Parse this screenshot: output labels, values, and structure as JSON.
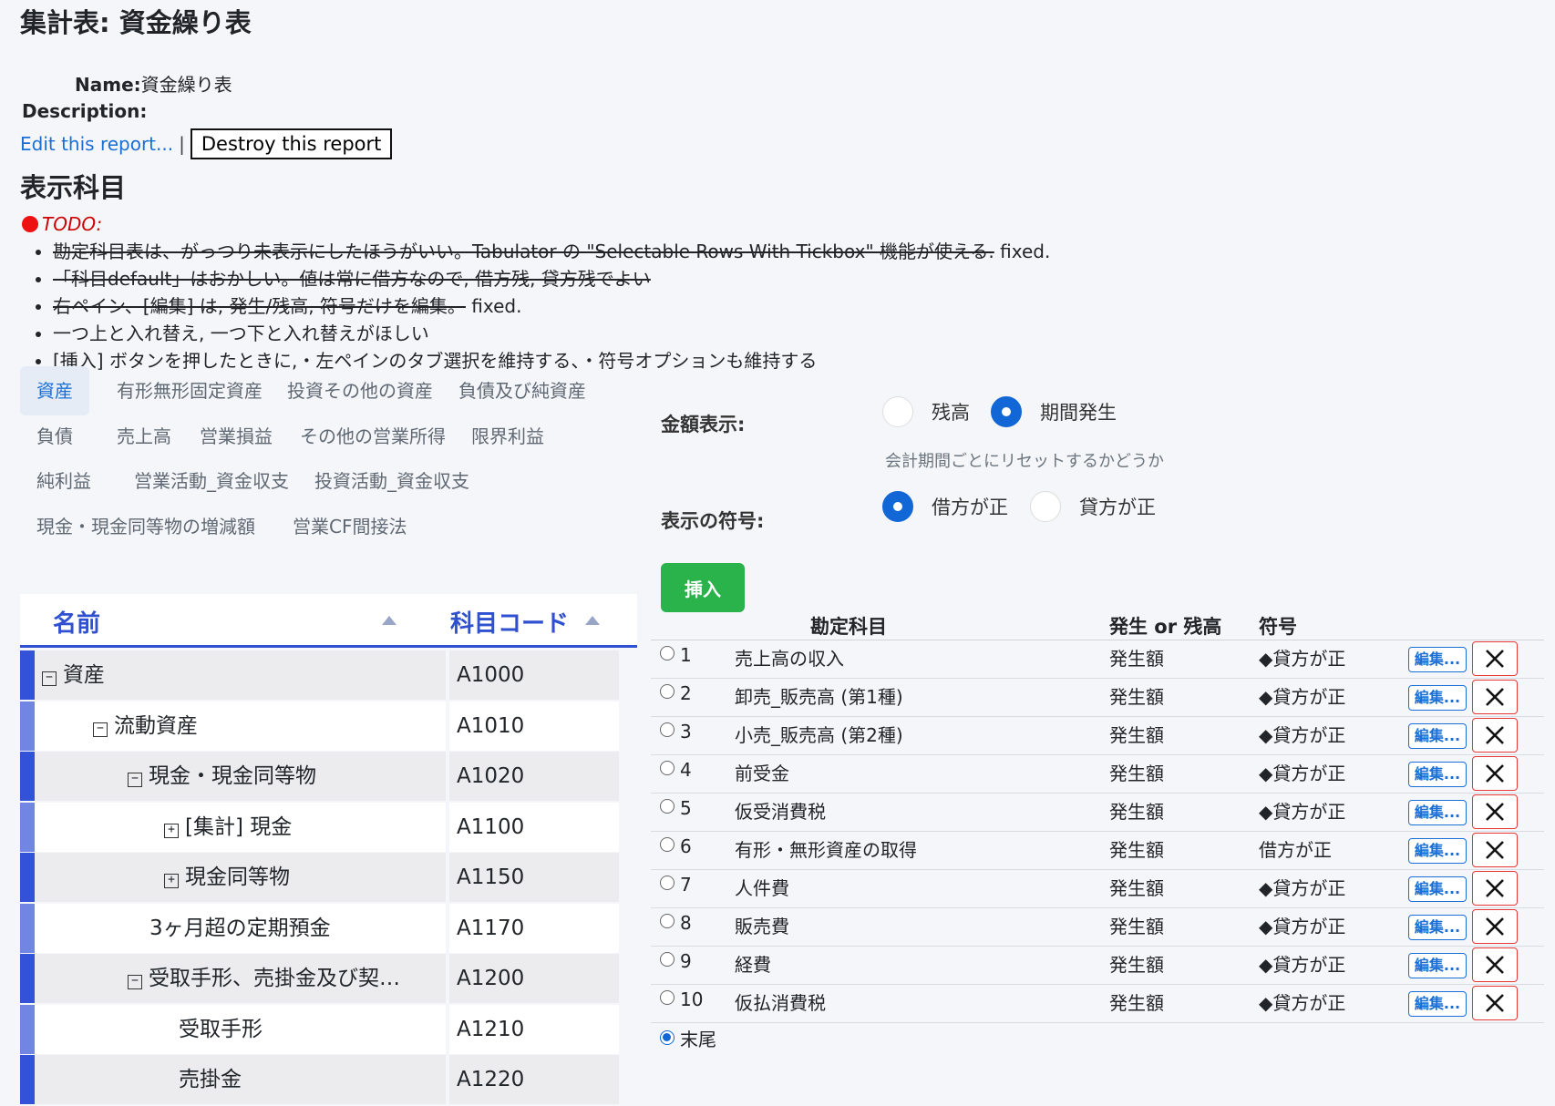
{
  "page": {
    "title": "集計表: 資金繰り表",
    "name_label": "Name:",
    "name_value": "資金繰り表",
    "description_label": "Description:",
    "edit_link": "Edit this report...",
    "separator": "|",
    "destroy_button": "Destroy this report"
  },
  "section_title": "表示科目",
  "todo": {
    "label": "TODO:",
    "items": [
      {
        "strike": "勘定科目表は、がっつり未表示にしたほうがいい。Tabulator の \"Selectable Rows With Tickbox\" 機能が使える.",
        "note": " fixed."
      },
      {
        "strike": "「科目default」はおかしい。値は常に借方なので, 借方残, 貸方残でよい",
        "note": ""
      },
      {
        "strike": "右ペイン、[編集] は, 発生/残高, 符号だけを編集。",
        "note": " fixed."
      },
      {
        "strike": "",
        "note": "一つ上と入れ替え, 一つ下と入れ替えがほしい"
      },
      {
        "strike": "",
        "note": "[挿入] ボタンを押したときに,・左ペインのタブ選択を維持する、・符号オプションも維持する"
      }
    ]
  },
  "tabs": [
    {
      "label": "資産",
      "active": true
    },
    {
      "label": "有形無形固定資産"
    },
    {
      "label": "投資その他の資産"
    },
    {
      "label": "負債及び純資産"
    },
    {
      "label": "負債"
    },
    {
      "label": "売上高"
    },
    {
      "label": "営業損益"
    },
    {
      "label": "その他の営業所得"
    },
    {
      "label": "限界利益"
    },
    {
      "label": "純利益"
    },
    {
      "label": "営業活動_資金収支"
    },
    {
      "label": "投資活動_資金収支"
    },
    {
      "label": "現金・現金同等物の増減額"
    },
    {
      "label": "営業CF間接法"
    }
  ],
  "tree": {
    "col_name": "名前",
    "col_code": "科目コード",
    "rows": [
      {
        "toggle": "−",
        "name": "資産",
        "code": "A1000"
      },
      {
        "toggle": "−",
        "name": "流動資産",
        "code": "A1010"
      },
      {
        "toggle": "−",
        "name": "現金・現金同等物",
        "code": "A1020"
      },
      {
        "toggle": "+",
        "name": "[集計] 現金",
        "code": "A1100"
      },
      {
        "toggle": "+",
        "name": "現金同等物",
        "code": "A1150"
      },
      {
        "toggle": "",
        "name": "3ヶ月超の定期預金",
        "code": "A1170"
      },
      {
        "toggle": "−",
        "name": "受取手形、売掛金及び契…",
        "code": "A1200"
      },
      {
        "toggle": "",
        "name": "受取手形",
        "code": "A1210"
      },
      {
        "toggle": "",
        "name": "売掛金",
        "code": "A1220"
      }
    ]
  },
  "options": {
    "amount_label": "金額表示:",
    "amount_options": [
      {
        "label": "残高",
        "selected": false
      },
      {
        "label": "期間発生",
        "selected": true
      }
    ],
    "amount_hint": "会計期間ごとにリセットするかどうか",
    "sign_label": "表示の符号:",
    "sign_options": [
      {
        "label": "借方が正",
        "selected": true
      },
      {
        "label": "貸方が正",
        "selected": false
      }
    ],
    "insert_button": "挿入"
  },
  "table": {
    "col_account": "勘定科目",
    "col_type": "発生 or 残高",
    "col_sign": "符号",
    "edit_label": "編集...",
    "rows": [
      {
        "no": "1",
        "account": "売上高の収入",
        "type": "発生額",
        "sign": "◆貸方が正"
      },
      {
        "no": "2",
        "account": "卸売_販売高 (第1種)",
        "type": "発生額",
        "sign": "◆貸方が正"
      },
      {
        "no": "3",
        "account": "小売_販売高 (第2種)",
        "type": "発生額",
        "sign": "◆貸方が正"
      },
      {
        "no": "4",
        "account": "前受金",
        "type": "発生額",
        "sign": "◆貸方が正"
      },
      {
        "no": "5",
        "account": "仮受消費税",
        "type": "発生額",
        "sign": "◆貸方が正"
      },
      {
        "no": "6",
        "account": "有形・無形資産の取得",
        "type": "発生額",
        "sign": "借方が正"
      },
      {
        "no": "7",
        "account": "人件費",
        "type": "発生額",
        "sign": "◆貸方が正"
      },
      {
        "no": "8",
        "account": "販売費",
        "type": "発生額",
        "sign": "◆貸方が正"
      },
      {
        "no": "9",
        "account": "経費",
        "type": "発生額",
        "sign": "◆貸方が正"
      },
      {
        "no": "10",
        "account": "仮払消費税",
        "type": "発生額",
        "sign": "◆貸方が正"
      }
    ],
    "tail_label": "末尾"
  },
  "colors": {
    "accent": "#1a6fd6",
    "tree_header": "#2f50d0",
    "bar_dark": "#3452d8",
    "bar_light": "#7186e2",
    "insert": "#2ab24b",
    "delete": "#e53935"
  }
}
